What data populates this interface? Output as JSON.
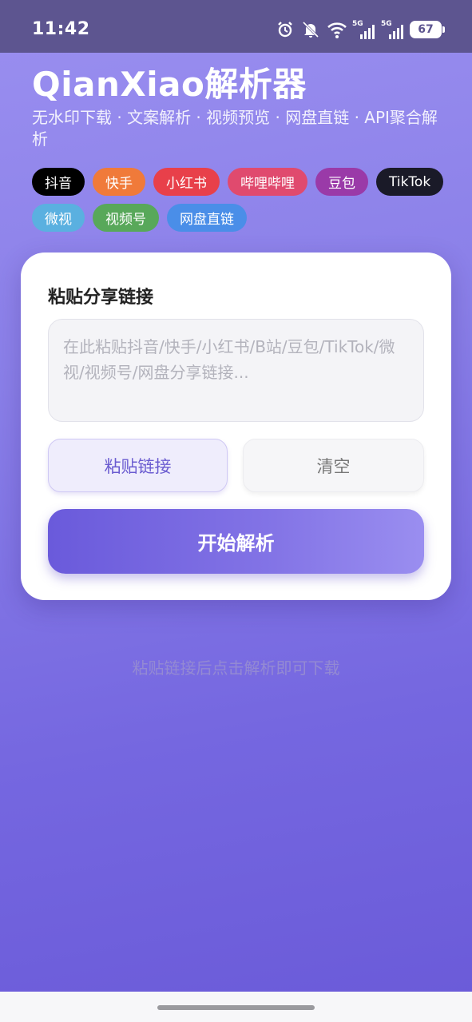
{
  "status_bar": {
    "time": "11:42",
    "icons": [
      "alarm-icon",
      "mute-bell-icon",
      "wifi-icon",
      "signal-5g-icon",
      "signal-5g-icon"
    ],
    "network_label": "5G",
    "network_label_2": "5G",
    "battery": "67"
  },
  "header": {
    "title": "QianXiao解析器",
    "subtitle": "无水印下载 · 文案解析 · 视频预览 · 网盘直链 · API聚合解析"
  },
  "platforms": [
    {
      "label": "抖音",
      "color": "#000000"
    },
    {
      "label": "快手",
      "color": "#f07a3a"
    },
    {
      "label": "小红书",
      "color": "#e8404a"
    },
    {
      "label": "哔哩哔哩",
      "color": "#e04a6e"
    },
    {
      "label": "豆包",
      "color": "#9a3aa8"
    },
    {
      "label": "TikTok",
      "color": "#1a1a28"
    },
    {
      "label": "微视",
      "color": "#5ab0e0"
    },
    {
      "label": "视频号",
      "color": "#58a85a"
    },
    {
      "label": "网盘直链",
      "color": "#4a8ee8"
    }
  ],
  "card": {
    "title": "粘贴分享链接",
    "input_placeholder": "在此粘贴抖音/快手/小红书/B站/豆包/TikTok/微视/视频号/网盘分享链接...",
    "input_value": "",
    "paste_button": "粘贴链接",
    "clear_button": "清空",
    "parse_button": "开始解析"
  },
  "hint": "粘贴链接后点击解析即可下载",
  "colors": {
    "accent": "#6a5bd0",
    "background_top": "#9a8ff0",
    "background_bottom": "#6a5ad8",
    "status_bar": "#5d5590"
  }
}
